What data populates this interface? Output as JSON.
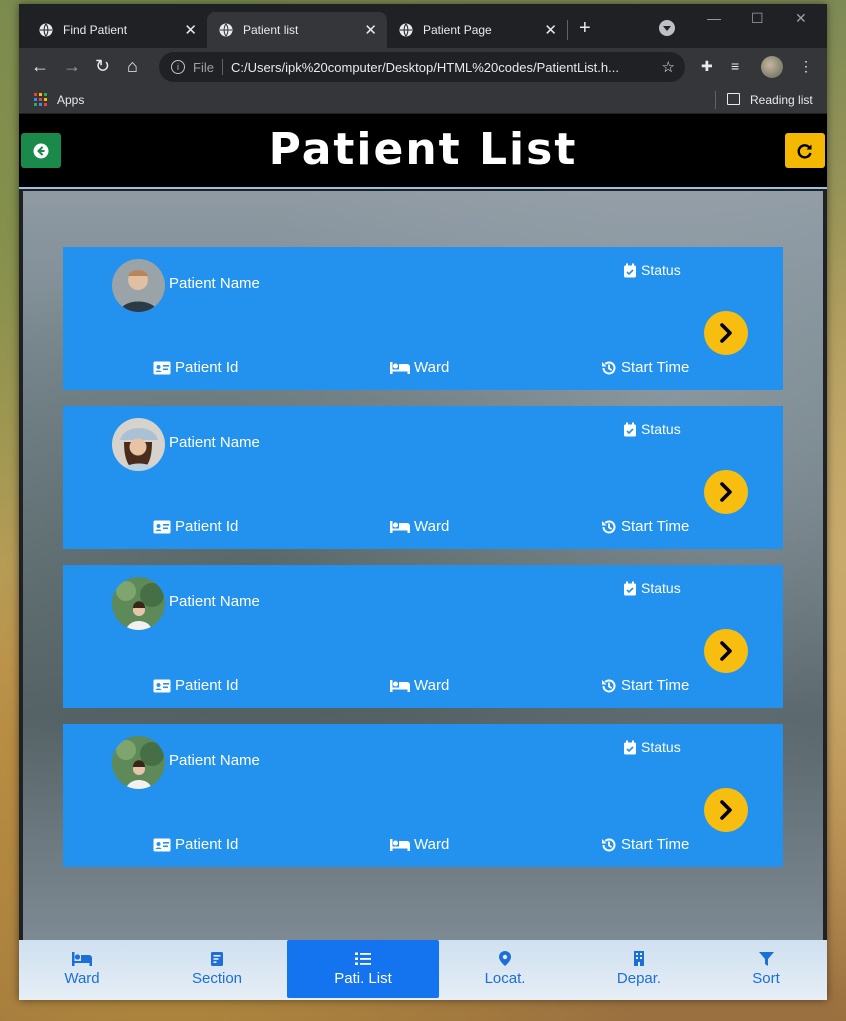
{
  "browser": {
    "tabs": [
      {
        "label": "Find Patient",
        "active": false
      },
      {
        "label": "Patient list",
        "active": true
      },
      {
        "label": "Patient Page",
        "active": false
      }
    ],
    "address": {
      "file_label": "File",
      "url": "C:/Users/ipk%20computer/Desktop/HTML%20codes/PatientList.h..."
    },
    "bookmarks": {
      "apps_label": "Apps",
      "reading_list_label": "Reading list"
    }
  },
  "header": {
    "title": "Patient List"
  },
  "patients": [
    {
      "name": "Patient Name",
      "status": "Status",
      "id": "Patient Id",
      "ward": "Ward",
      "start_time": "Start Time",
      "avatar": "avatar-man"
    },
    {
      "name": "Patient Name",
      "status": "Status",
      "id": "Patient Id",
      "ward": "Ward",
      "start_time": "Start Time",
      "avatar": "avatar-woman-hat"
    },
    {
      "name": "Patient Name",
      "status": "Status",
      "id": "Patient Id",
      "ward": "Ward",
      "start_time": "Start Time",
      "avatar": "avatar-woman-forest"
    },
    {
      "name": "Patient Name",
      "status": "Status",
      "id": "Patient Id",
      "ward": "Ward",
      "start_time": "Start Time",
      "avatar": "avatar-woman-forest"
    }
  ],
  "bottom_nav": [
    {
      "label": "Ward",
      "icon": "bed-icon",
      "active": false
    },
    {
      "label": "Section",
      "icon": "section-icon",
      "active": false
    },
    {
      "label": "Pati. List",
      "icon": "list-icon",
      "active": true
    },
    {
      "label": "Locat.",
      "icon": "location-icon",
      "active": false
    },
    {
      "label": "Depar.",
      "icon": "building-icon",
      "active": false
    },
    {
      "label": "Sort",
      "icon": "filter-icon",
      "active": false
    }
  ],
  "colors": {
    "card": "#2292ee",
    "go_button": "#f7be10",
    "back_button": "#1a8a4a",
    "refresh_button": "#f5b800",
    "nav_active": "#1474f0",
    "nav_text": "#1b6fd6"
  }
}
